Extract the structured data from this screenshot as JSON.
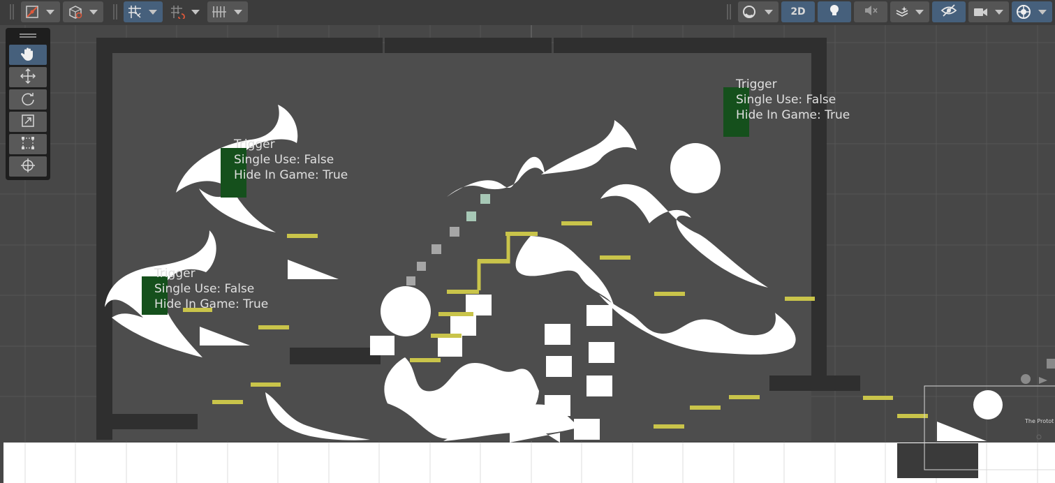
{
  "toolbar": {
    "left": [
      {
        "icon": "snap-increment-icon",
        "dropdown": true
      },
      {
        "icon": "gizmo-cube-icon",
        "dropdown": true
      },
      {
        "icon": "grid-snapping-icon",
        "dropdown": true,
        "active": true
      },
      {
        "icon": "snap-to-grid-icon",
        "dropdown": true
      },
      {
        "icon": "grid-visibility-icon",
        "dropdown": true
      }
    ],
    "right": [
      {
        "icon": "draw-mode-sphere-icon",
        "dropdown": true
      },
      {
        "label": "2D",
        "active": true
      },
      {
        "icon": "lighting-bulb-icon",
        "active": true
      },
      {
        "icon": "audio-mute-icon"
      },
      {
        "icon": "effects-layers-icon",
        "dropdown": true
      },
      {
        "icon": "hidden-objects-eye-icon",
        "active": true
      },
      {
        "icon": "scene-camera-icon",
        "dropdown": true
      },
      {
        "icon": "gizmos-icon",
        "dropdown": true,
        "active": true
      }
    ],
    "mode_2d_label": "2D"
  },
  "tools": [
    "hand-tool-icon",
    "move-tool-icon",
    "rotate-tool-icon",
    "scale-tool-icon",
    "rect-tool-icon",
    "transform-tool-icon"
  ],
  "active_tool": "hand-tool-icon",
  "triggers": [
    {
      "title": "Trigger",
      "single_use": "Single Use: False",
      "hide_in_game": "Hide In Game: True"
    },
    {
      "title": "Trigger",
      "single_use": "Single Use: False",
      "hide_in_game": "Hide In Game: True"
    },
    {
      "title": "Trigger",
      "single_use": "Single Use: False",
      "hide_in_game": "Hide In Game: True"
    }
  ],
  "camera_label": "The Protot",
  "colors": {
    "toolbar_bg": "#3c3c3c",
    "button_bg": "#555555",
    "active_button": "#46607c",
    "scene_bg": "#474747",
    "wall": "#2e2e2e",
    "platform_yellow": "#c9c44a",
    "trigger_green": "#15501c",
    "sprite_white": "#ffffff"
  }
}
